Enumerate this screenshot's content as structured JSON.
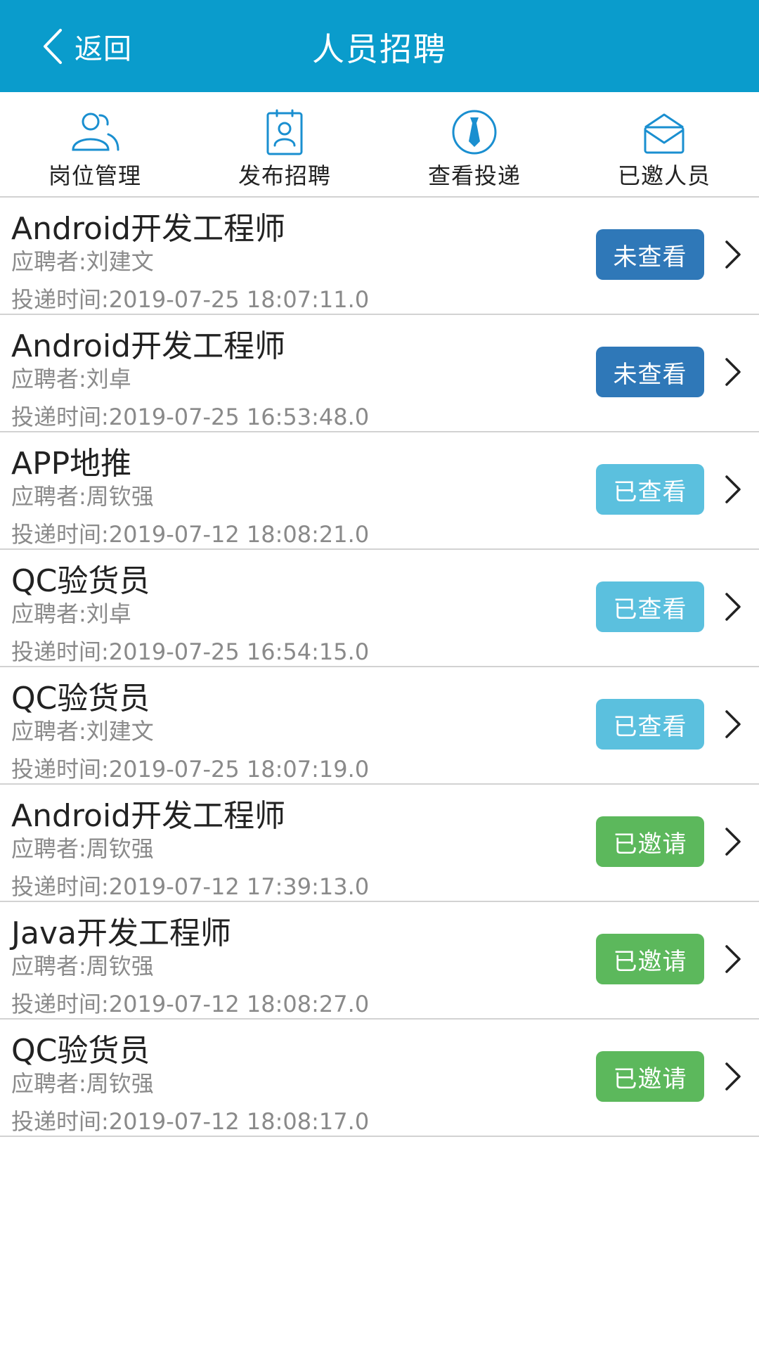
{
  "header": {
    "back_label": "返回",
    "title": "人员招聘",
    "bg_color": "#0a9ccc"
  },
  "toolbar": [
    {
      "label": "岗位管理",
      "icon": "users-icon"
    },
    {
      "label": "发布招聘",
      "icon": "id-card-icon"
    },
    {
      "label": "查看投递",
      "icon": "tie-icon"
    },
    {
      "label": "已邀人员",
      "icon": "envelope-icon"
    }
  ],
  "status_colors": {
    "未查看": "#2f78b8",
    "已查看": "#5bc0de",
    "已邀请": "#5cb85c"
  },
  "items": [
    {
      "job": "Android开发工程师",
      "applicant": "应聘者:刘建文",
      "time": "投递时间:2019-07-25 18:07:11.0",
      "status": "未查看"
    },
    {
      "job": "Android开发工程师",
      "applicant": "应聘者:刘卓",
      "time": "投递时间:2019-07-25 16:53:48.0",
      "status": "未查看"
    },
    {
      "job": "APP地推",
      "applicant": "应聘者:周钦强",
      "time": "投递时间:2019-07-12 18:08:21.0",
      "status": "已查看"
    },
    {
      "job": "QC验货员",
      "applicant": "应聘者:刘卓",
      "time": "投递时间:2019-07-25 16:54:15.0",
      "status": "已查看"
    },
    {
      "job": "QC验货员",
      "applicant": "应聘者:刘建文",
      "time": "投递时间:2019-07-25 18:07:19.0",
      "status": "已查看"
    },
    {
      "job": "Android开发工程师",
      "applicant": "应聘者:周钦强",
      "time": "投递时间:2019-07-12 17:39:13.0",
      "status": "已邀请"
    },
    {
      "job": "Java开发工程师",
      "applicant": "应聘者:周钦强",
      "time": "投递时间:2019-07-12 18:08:27.0",
      "status": "已邀请"
    },
    {
      "job": "QC验货员",
      "applicant": "应聘者:周钦强",
      "time": "投递时间:2019-07-12 18:08:17.0",
      "status": "已邀请"
    }
  ]
}
